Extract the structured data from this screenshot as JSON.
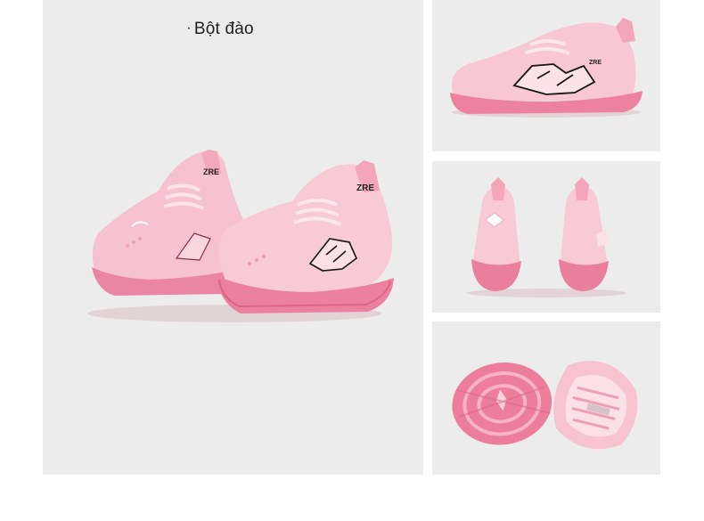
{
  "caption": {
    "bullet": "·",
    "color_name": "Bột đào"
  },
  "colors": {
    "panel_background": "#ececec",
    "shoe_pink": "#f4b8c9",
    "shoe_light_pink": "#fad1dd",
    "sole_pink": "#ee8aa6",
    "sole_deep_pink": "#e4708f",
    "logo_black": "#1a1a1a"
  },
  "images": [
    {
      "name": "pair-three-quarter-view",
      "icon": "sneaker-pair-photo"
    },
    {
      "name": "side-view",
      "icon": "sneaker-side-photo"
    },
    {
      "name": "heel-rear-view",
      "icon": "sneaker-heel-photo"
    },
    {
      "name": "outsole-bottom-view",
      "icon": "sneaker-sole-photo"
    }
  ]
}
